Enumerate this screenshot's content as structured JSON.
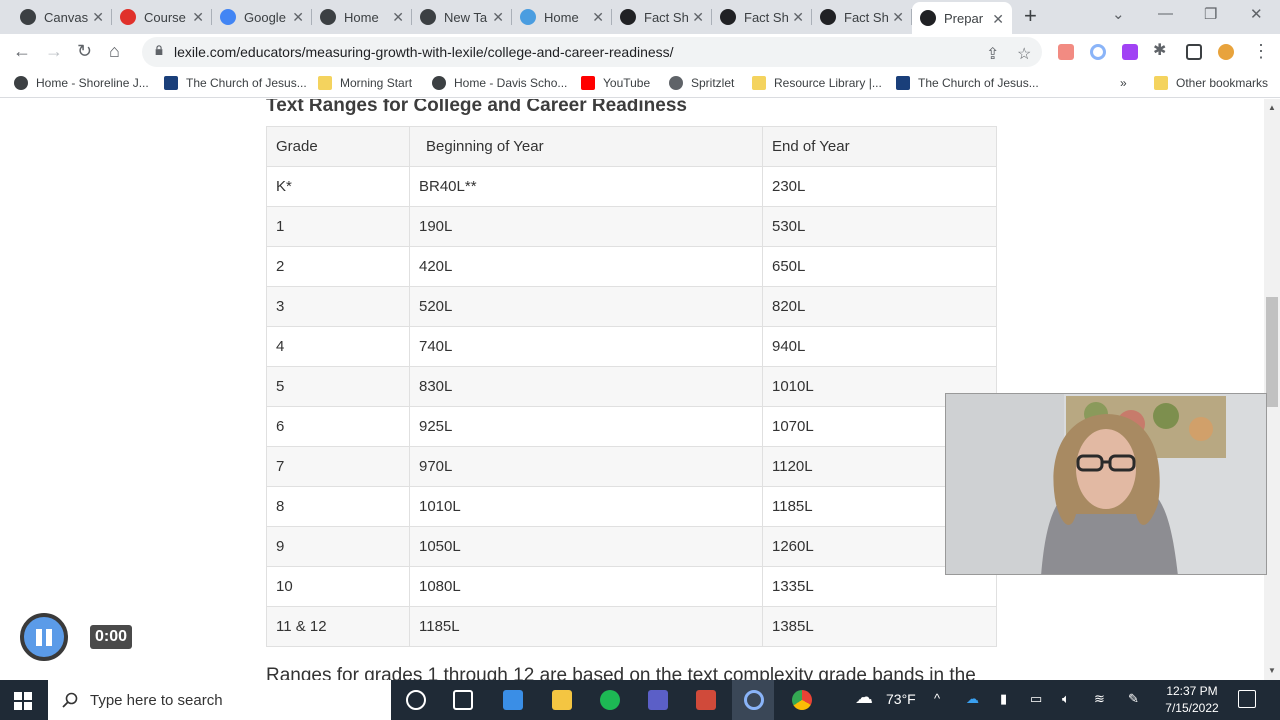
{
  "browser": {
    "tabs": [
      {
        "label": "Canvas",
        "icon": "canvas-icon",
        "color": "#3c4043"
      },
      {
        "label": "Course",
        "icon": "canvas-red-icon",
        "color": "#e0312b"
      },
      {
        "label": "Google",
        "icon": "google-icon",
        "color": "#4285f4"
      },
      {
        "label": "Home",
        "icon": "home-site-icon",
        "color": "#3c4043"
      },
      {
        "label": "New Tab",
        "icon": "chrome-icon",
        "color": "#3c4043"
      },
      {
        "label": "Home",
        "icon": "circle-app-icon",
        "color": "#4a9de0"
      },
      {
        "label": "Fact Sh",
        "icon": "lexile-icon",
        "color": "#202124"
      },
      {
        "label": "Fact Sh",
        "icon": "lexile-icon",
        "color": "#202124"
      },
      {
        "label": "Fact Sh",
        "icon": "lexile-icon",
        "color": "#202124"
      },
      {
        "label": "Prepar",
        "icon": "lexile-icon",
        "color": "#202124",
        "active": true
      }
    ],
    "url": "lexile.com/educators/measuring-growth-with-lexile/college-and-career-readiness/",
    "bookmarks": [
      {
        "label": "Home - Shoreline J...",
        "icon": "site-icon",
        "color": "#3c4043"
      },
      {
        "label": "The Church of Jesus...",
        "icon": "church-icon",
        "color": "#1a3f7a"
      },
      {
        "label": "Morning Start",
        "icon": "folder-icon",
        "color": "#f4d35e"
      },
      {
        "label": "Home - Davis Scho...",
        "icon": "site-icon",
        "color": "#3c4043"
      },
      {
        "label": "YouTube",
        "icon": "youtube-icon",
        "color": "#ff0000"
      },
      {
        "label": "Spritzlet",
        "icon": "globe-icon",
        "color": "#5f6368"
      },
      {
        "label": "Resource Library |...",
        "icon": "bookmark-icon",
        "color": "#f4d35e"
      },
      {
        "label": "The Church of Jesus...",
        "icon": "church-icon",
        "color": "#1a3f7a"
      }
    ],
    "more_bookmarks": "»",
    "other_bookmarks": "Other bookmarks"
  },
  "page": {
    "heading": "Text Ranges for College and Career Readiness",
    "table": {
      "headers": [
        "Grade",
        "Beginning of Year",
        "End of Year"
      ],
      "rows": [
        [
          "K*",
          "BR40L**",
          "230L"
        ],
        [
          "1",
          "190L",
          "530L"
        ],
        [
          "2",
          "420L",
          "650L"
        ],
        [
          "3",
          "520L",
          "820L"
        ],
        [
          "4",
          "740L",
          "940L"
        ],
        [
          "5",
          "830L",
          "1010L"
        ],
        [
          "6",
          "925L",
          "1070L"
        ],
        [
          "7",
          "970L",
          "1120L"
        ],
        [
          "8",
          "1010L",
          "1185L"
        ],
        [
          "9",
          "1050L",
          "1260L"
        ],
        [
          "10",
          "1080L",
          "1335L"
        ],
        [
          "11 & 12",
          "1185L",
          "1385L"
        ]
      ]
    },
    "paragraph": "Ranges for grades 1 through 12 are based on the text complexity grade bands in the"
  },
  "recorder": {
    "time": "0:00"
  },
  "taskbar": {
    "search_placeholder": "Type here to search",
    "weather": "73°F",
    "time": "12:37 PM",
    "date": "7/15/2022"
  }
}
